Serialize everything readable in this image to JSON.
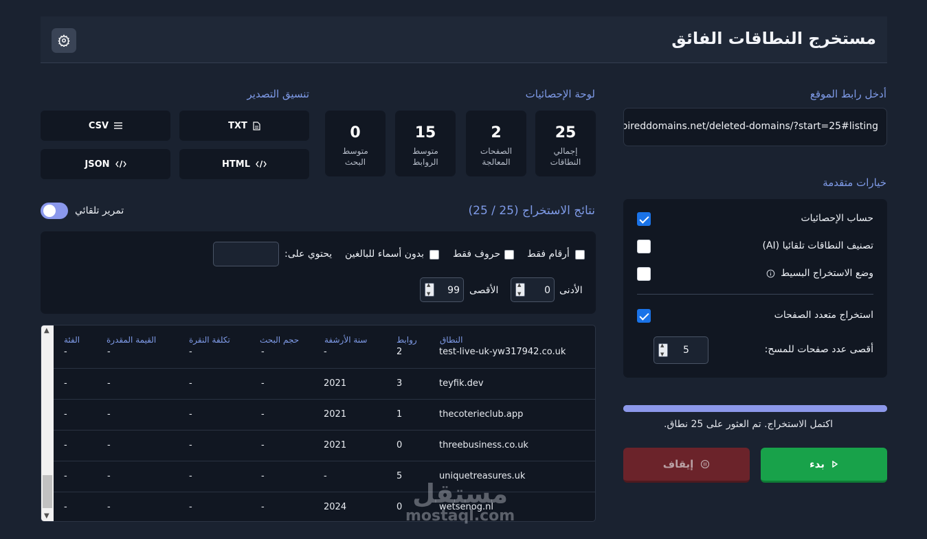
{
  "app": {
    "title": "مستخرج النطاقات الفائق"
  },
  "url_section": {
    "label": "أدخل رابط الموقع",
    "value": "pireddomains.net/deleted-domains/?start=25#listing"
  },
  "advanced": {
    "title": "خيارات متقدمة",
    "options": [
      {
        "label": "حساب الإحصائيات",
        "checked": true
      },
      {
        "label": "تصنيف النطاقات تلقائيا (AI)",
        "checked": false
      },
      {
        "label": "وضع الاستخراج البسيط",
        "checked": false
      },
      {
        "label": "استخراج متعدد الصفحات",
        "checked": true
      }
    ],
    "max_pages_label": "أقصى عدد صفحات للمسح:",
    "max_pages_value": "5"
  },
  "progress": {
    "percent": 100,
    "text": "اكتمل الاستخراج. تم العثور على 25 نطاق."
  },
  "buttons": {
    "start": "بدء",
    "stop": "إيقاف"
  },
  "stats": {
    "title": "لوحة الإحصائيات",
    "items": [
      {
        "value": "25",
        "label": "إجمالي النطاقات"
      },
      {
        "value": "2",
        "label": "الصفحات المعالجة"
      },
      {
        "value": "15",
        "label": "متوسط الروابط"
      },
      {
        "value": "0",
        "label": "متوسط البحث"
      }
    ]
  },
  "export": {
    "title": "تنسيق التصدير",
    "txt": "TXT",
    "csv": "CSV",
    "html": "HTML",
    "json": "JSON"
  },
  "results": {
    "title": "نتائج الاستخراج (25 / 25)",
    "auto_scroll": "تمرير تلقائي"
  },
  "filters": {
    "numbers_only": "أرقام فقط",
    "letters_only": "حروف فقط",
    "no_adult": "بدون أسماء للبالغين",
    "contains": "يحتوي على:",
    "min_label": "الأدنى",
    "min_value": "0",
    "max_label": "الأقصى",
    "max_value": "99"
  },
  "table": {
    "headers": [
      "النطاق",
      "روابط",
      "سنة الأرشفة",
      "حجم البحث",
      "تكلفة النقرة",
      "القيمة المقدرة",
      "الفئة"
    ],
    "rows": [
      [
        "test-live-uk-yw317942.co.uk",
        "2",
        "-",
        "-",
        "-",
        "-",
        "-"
      ],
      [
        "teyfik.dev",
        "3",
        "2021",
        "-",
        "-",
        "-",
        "-"
      ],
      [
        "thecoterieclub.app",
        "1",
        "2021",
        "-",
        "-",
        "-",
        "-"
      ],
      [
        "threebusiness.co.uk",
        "0",
        "2021",
        "-",
        "-",
        "-",
        "-"
      ],
      [
        "uniquetreasures.uk",
        "5",
        "-",
        "-",
        "-",
        "-",
        "-"
      ],
      [
        "wetsenog.nl",
        "0",
        "2024",
        "-",
        "-",
        "-",
        "-"
      ]
    ]
  },
  "watermark": {
    "ar": "مستقل",
    "en": "mostaql.com"
  },
  "colors": {
    "accent": "#7f9be8",
    "start": "#18a24a",
    "stop": "#6b232a",
    "bg": "#1a2230",
    "card": "#111722"
  }
}
